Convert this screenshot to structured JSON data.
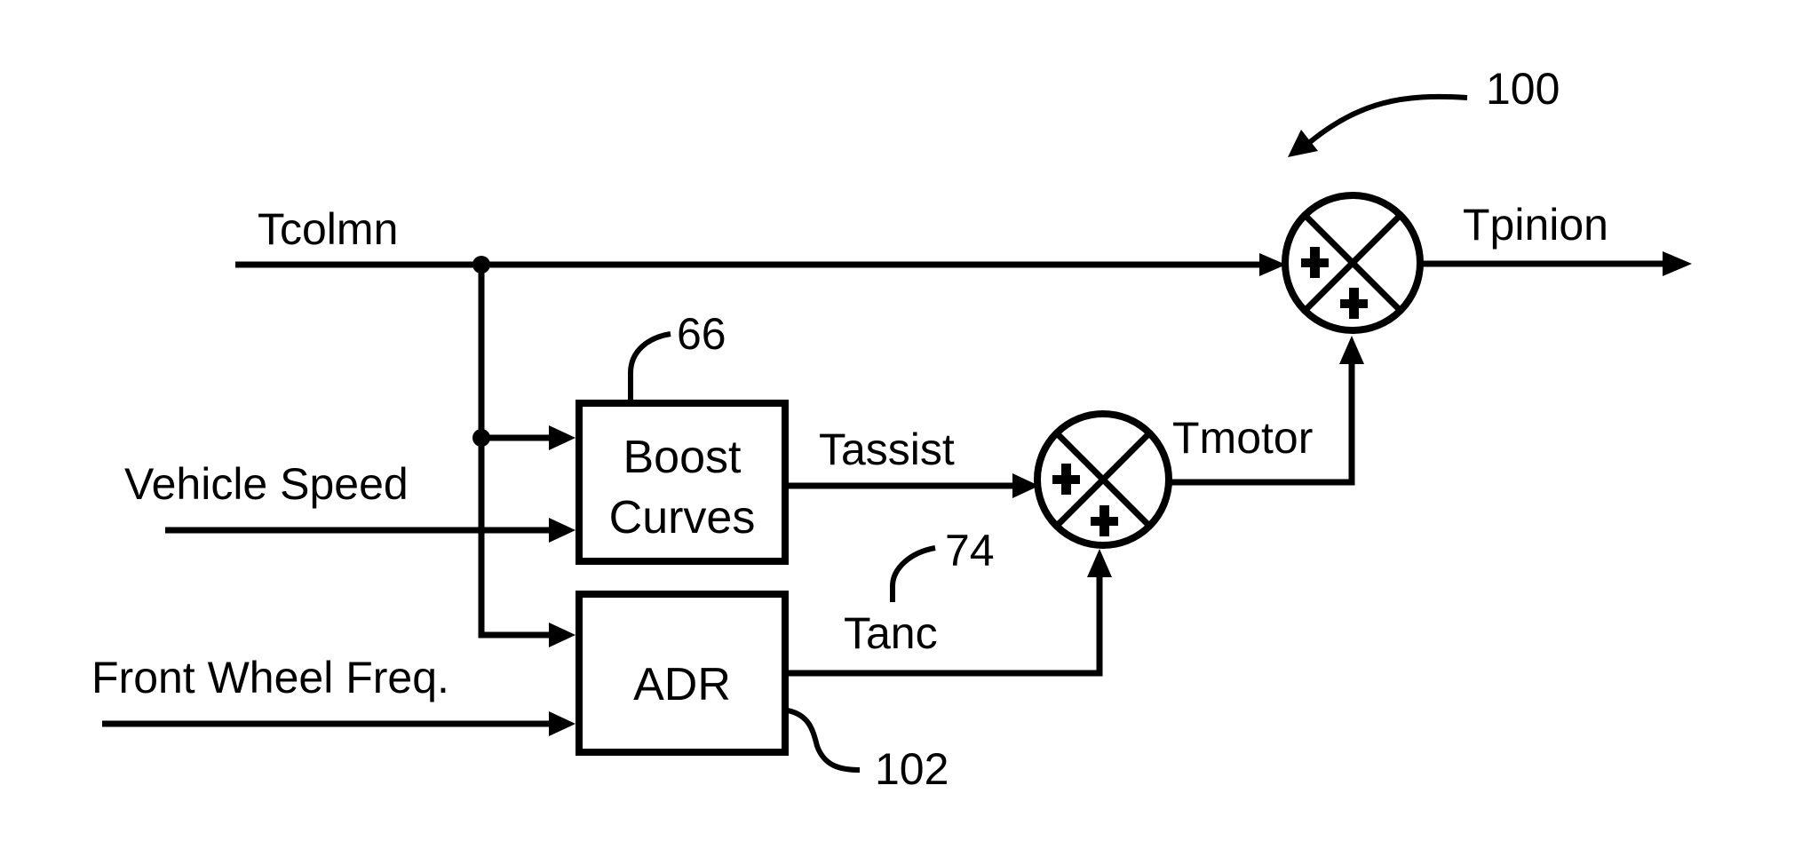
{
  "diagram": {
    "reference_numeral": "100",
    "inputs": {
      "tcolmn": "Tcolmn",
      "vehicle_speed": "Vehicle Speed",
      "front_wheel_freq": "Front Wheel Freq."
    },
    "blocks": {
      "boost_curves": {
        "line1": "Boost",
        "line2": "Curves",
        "ref": "66"
      },
      "adr": {
        "label": "ADR",
        "ref": "102"
      }
    },
    "signals": {
      "tassist": "Tassist",
      "tanc": "Tanc",
      "tanc_ref": "74",
      "tmotor": "Tmotor",
      "tpinion": "Tpinion"
    },
    "summing_junctions": {
      "sum_motor": {
        "upper_sign": "+",
        "lower_sign": "+"
      },
      "sum_pinion": {
        "upper_sign": "+",
        "lower_sign": "+"
      }
    },
    "colors": {
      "ink": "#000000",
      "background": "#ffffff"
    }
  }
}
